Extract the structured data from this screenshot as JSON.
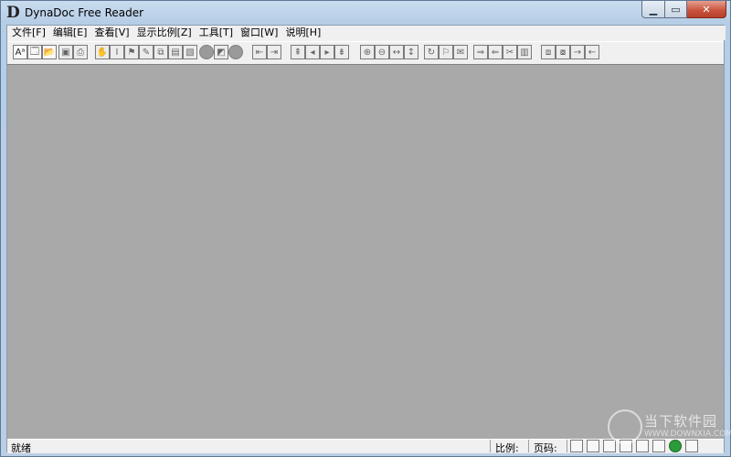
{
  "window": {
    "title": "DynaDoc Free Reader",
    "icon_glyph": "D",
    "buttons": {
      "minimize": "▁",
      "maximize": "▭",
      "close": "✕"
    }
  },
  "menu": [
    {
      "label": "文件[F]"
    },
    {
      "label": "编辑[E]"
    },
    {
      "label": "查看[V]"
    },
    {
      "label": "显示比例[Z]"
    },
    {
      "label": "工具[T]"
    },
    {
      "label": "窗口[W]"
    },
    {
      "label": "说明[H]"
    }
  ],
  "toolbar": {
    "buttons": [
      {
        "name": "text-select-icon",
        "glyph": "Aᵃ",
        "enabled": true
      },
      {
        "name": "new-window-icon",
        "glyph": "🗔",
        "enabled": true
      },
      {
        "name": "open-folder-icon",
        "glyph": "📂",
        "enabled": true
      },
      {
        "name": "save-icon",
        "glyph": "▣",
        "enabled": false
      },
      {
        "name": "print-icon",
        "glyph": "⎙",
        "enabled": false
      },
      {
        "name": "hand-tool-icon",
        "glyph": "✋",
        "enabled": false
      },
      {
        "name": "text-cursor-icon",
        "glyph": "I",
        "enabled": false
      },
      {
        "name": "stamp-icon",
        "glyph": "⚑",
        "enabled": false
      },
      {
        "name": "pencil-icon",
        "glyph": "✎",
        "enabled": false
      },
      {
        "name": "page-copy-icon",
        "glyph": "⧉",
        "enabled": false
      },
      {
        "name": "page-view-icon",
        "glyph": "▤",
        "enabled": false
      },
      {
        "name": "image-icon",
        "glyph": "▧",
        "enabled": false
      },
      {
        "name": "circle-tool-icon",
        "glyph": "",
        "enabled": false
      },
      {
        "name": "layers-icon",
        "glyph": "◩",
        "enabled": false
      },
      {
        "name": "circle-record-icon",
        "glyph": "",
        "enabled": false
      },
      {
        "name": "back-history-icon",
        "glyph": "⇤",
        "enabled": false
      },
      {
        "name": "forward-history-icon",
        "glyph": "⇥",
        "enabled": false
      },
      {
        "name": "first-page-icon",
        "glyph": "⇞",
        "enabled": false
      },
      {
        "name": "prev-page-icon",
        "glyph": "◂",
        "enabled": false
      },
      {
        "name": "next-page-icon",
        "glyph": "▸",
        "enabled": false
      },
      {
        "name": "last-page-icon",
        "glyph": "⇟",
        "enabled": false
      },
      {
        "name": "zoom-in-icon",
        "glyph": "⊕",
        "enabled": false
      },
      {
        "name": "zoom-out-icon",
        "glyph": "⊖",
        "enabled": false
      },
      {
        "name": "fit-width-icon",
        "glyph": "↔",
        "enabled": false
      },
      {
        "name": "fit-page-icon",
        "glyph": "↕",
        "enabled": false
      },
      {
        "name": "rotate-icon",
        "glyph": "↻",
        "enabled": false
      },
      {
        "name": "bookmark-icon",
        "glyph": "⚐",
        "enabled": false
      },
      {
        "name": "mail-icon",
        "glyph": "✉",
        "enabled": false
      },
      {
        "name": "arrow-right-doc-icon",
        "glyph": "⇒",
        "enabled": false
      },
      {
        "name": "arrow-left-doc-icon",
        "glyph": "⇐",
        "enabled": false
      },
      {
        "name": "scissors-icon",
        "glyph": "✂",
        "enabled": false
      },
      {
        "name": "clipboard-icon",
        "glyph": "▥",
        "enabled": false
      },
      {
        "name": "tile-windows-icon",
        "glyph": "⧈",
        "enabled": false
      },
      {
        "name": "cascade-windows-icon",
        "glyph": "⧇",
        "enabled": false
      },
      {
        "name": "arrow-right-icon",
        "glyph": "→",
        "enabled": false
      },
      {
        "name": "arrow-left-icon",
        "glyph": "←",
        "enabled": false
      }
    ]
  },
  "status": {
    "ready": "就绪",
    "scale_label": "比例:",
    "page_label": "页码:",
    "icons": [
      "single-page-icon",
      "facing-pages-icon",
      "continuous-icon",
      "thumbnail-icon",
      "book-view-icon",
      "network-icon",
      "globe-icon",
      "save-status-icon"
    ]
  },
  "watermark": {
    "text": "当下软件园",
    "url": "WWW.DOWNXIA.COM"
  }
}
